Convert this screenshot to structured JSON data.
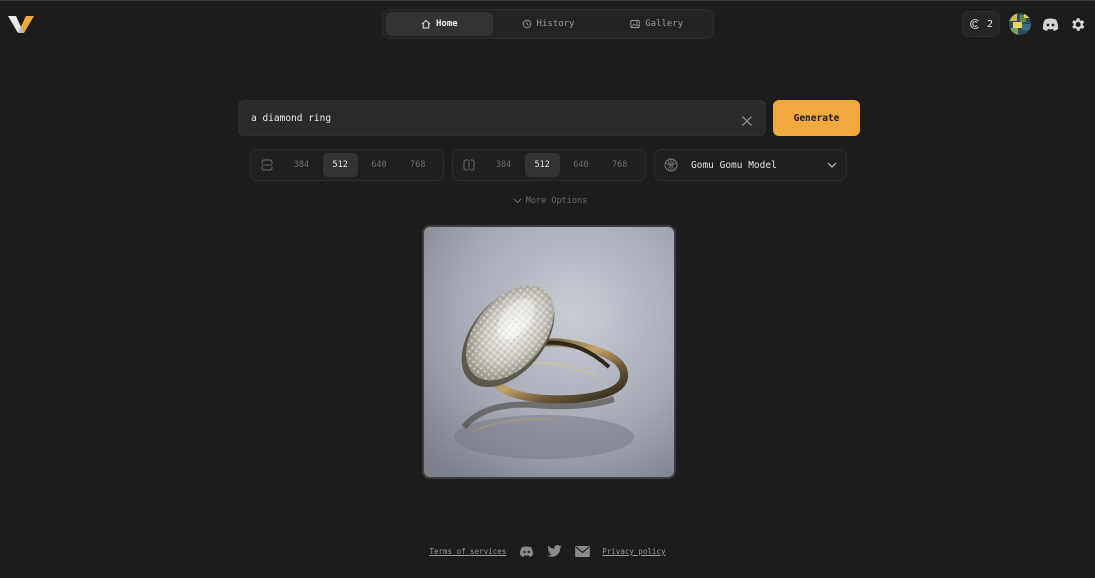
{
  "app": {
    "logo": "v-logo-icon"
  },
  "nav": {
    "tabs": [
      {
        "label": "Home",
        "icon": "home-icon",
        "active": true
      },
      {
        "label": "History",
        "icon": "history-icon",
        "active": false
      },
      {
        "label": "Gallery",
        "icon": "gallery-icon",
        "active": false
      }
    ]
  },
  "header": {
    "credits": {
      "icon": "credits-icon",
      "value": "2"
    },
    "avatar": "user-avatar",
    "discord_icon": "discord-icon",
    "settings_icon": "gear-icon"
  },
  "prompt": {
    "value": "a diamond ring",
    "clear_icon": "close-icon"
  },
  "generate": {
    "label": "Generate",
    "color": "#f0a93c"
  },
  "width_selector": {
    "icon": "width-icon",
    "options": [
      "384",
      "512",
      "640",
      "768"
    ],
    "selected": "512"
  },
  "height_selector": {
    "icon": "height-icon",
    "options": [
      "384",
      "512",
      "640",
      "768"
    ],
    "selected": "512"
  },
  "model": {
    "icon": "model-icon",
    "label": "Gomu Gomu Model",
    "dropdown_icon": "chevron-down-icon"
  },
  "more_options": {
    "label": "More Options",
    "icon": "chevron-down-icon"
  },
  "result": {
    "subject": "diamond ring"
  },
  "footer": {
    "terms": "Terms of services",
    "privacy": "Privacy policy",
    "icons": [
      "discord-icon",
      "twitter-icon",
      "mail-icon"
    ]
  }
}
